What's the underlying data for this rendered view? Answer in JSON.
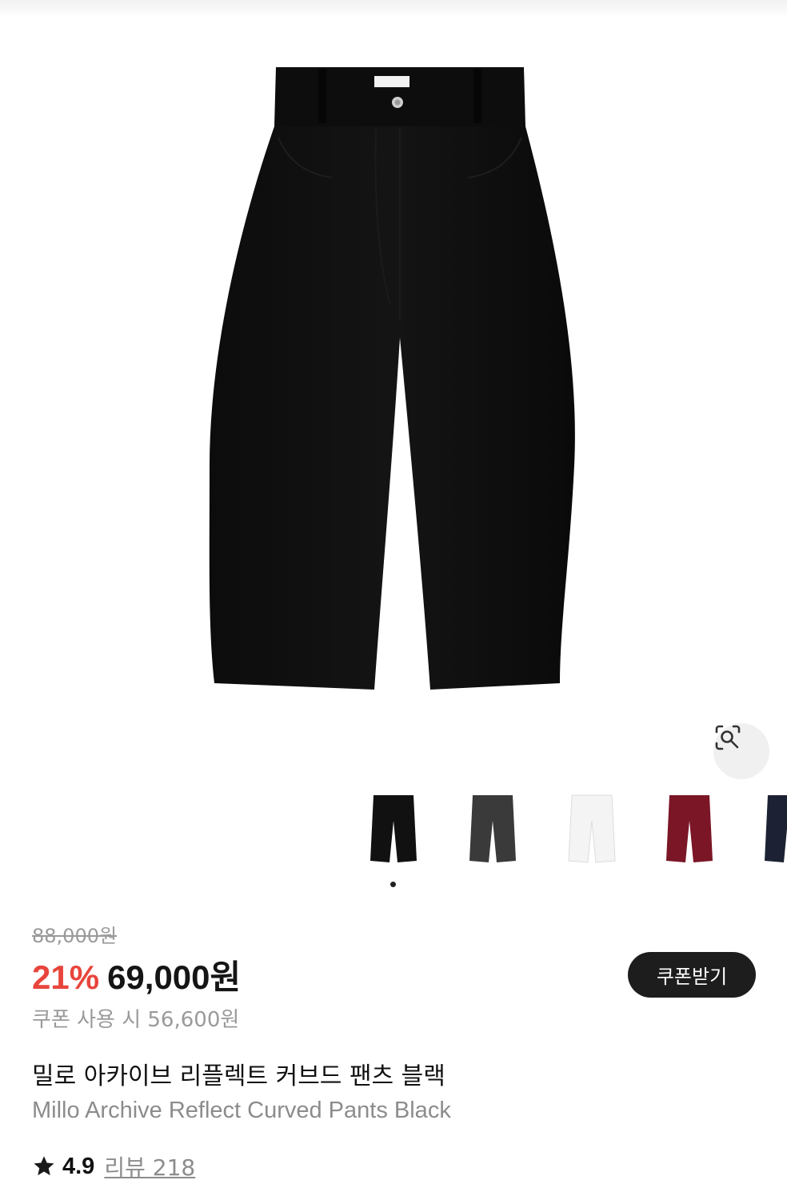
{
  "product": {
    "original_price": "88,000원",
    "discount": "21%",
    "sale_price": "69,000원",
    "coupon_price": "쿠폰 사용 시 56,600원",
    "coupon_button_label": "쿠폰받기",
    "title_ko": "밀로 아카이브 리플렉트 커브드 팬츠 블랙",
    "title_en": "Millo Archive Reflect Curved Pants Black"
  },
  "rating": {
    "score": "4.9",
    "review_label": "리뷰 218"
  },
  "gallery": {
    "icon": "lens-search-icon",
    "variants": [
      {
        "name": "black",
        "color": "#111111"
      },
      {
        "name": "washed-black",
        "color": "#3a3a3a"
      },
      {
        "name": "white",
        "color": "#f4f4f4"
      },
      {
        "name": "burgundy",
        "color": "#7b1626"
      },
      {
        "name": "navy",
        "color": "#1c2233"
      }
    ],
    "active_index": 0
  },
  "colors": {
    "discount": "#e8453c",
    "button_bg": "#1d1d1d",
    "muted": "#9a9a9a"
  }
}
